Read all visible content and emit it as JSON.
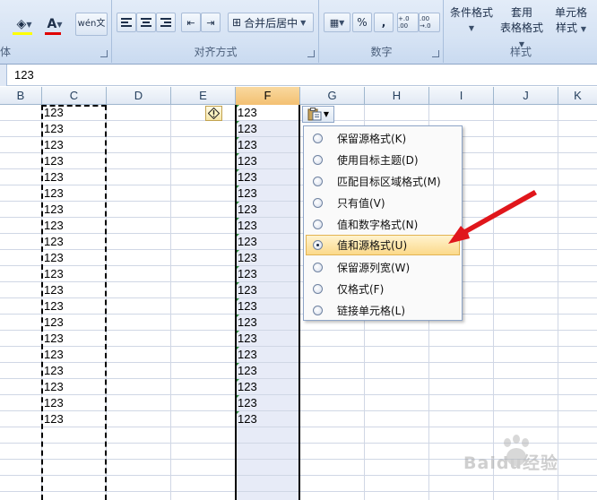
{
  "ribbon": {
    "font_group_label_partial": "体",
    "wen_button": "wén文",
    "alignment_group_label": "对齐方式",
    "merge_center": "合并后居中",
    "number_group_label": "数字",
    "percent": "%",
    "comma": ",",
    "increase_decimal": "+.0 .00",
    "decrease_decimal": ".00 →.0",
    "styles_group_label": "样式",
    "conditional_format": "条件格式",
    "table_format_l1": "套用",
    "table_format_l2": "表格格式",
    "cell_style_l1": "单元格",
    "cell_style_l2": "样式"
  },
  "formula_bar": {
    "value": "123"
  },
  "columns": [
    "B",
    "C",
    "D",
    "E",
    "F",
    "G",
    "H",
    "I",
    "J",
    "K"
  ],
  "selected_column": "F",
  "cells": {
    "C": [
      "123",
      "123",
      "123",
      "123",
      "123",
      "123",
      "123",
      "123",
      "123",
      "123",
      "123",
      "123",
      "123",
      "123",
      "123",
      "123",
      "123",
      "123",
      "123",
      "123"
    ],
    "F": [
      "123",
      "123",
      "123",
      "123",
      "123",
      "123",
      "123",
      "123",
      "123",
      "123",
      "123",
      "123",
      "123",
      "123",
      "123",
      "123",
      "123",
      "123",
      "123",
      "123"
    ]
  },
  "paste_menu": {
    "items": [
      {
        "label": "保留源格式(K)",
        "selected": false
      },
      {
        "label": "使用目标主题(D)",
        "selected": false
      },
      {
        "label": "匹配目标区域格式(M)",
        "selected": false
      },
      {
        "label": "只有值(V)",
        "selected": false
      },
      {
        "label": "值和数字格式(N)",
        "selected": false
      },
      {
        "label": "值和源格式(U)",
        "selected": true
      },
      {
        "label": "保留源列宽(W)",
        "selected": false
      },
      {
        "label": "仅格式(F)",
        "selected": false
      },
      {
        "label": "链接单元格(L)",
        "selected": false
      }
    ]
  },
  "watermark": {
    "text": "Baidu经验"
  },
  "colors": {
    "selected_header": "#f3c072",
    "menu_highlight": "#fbd98a",
    "annotation_arrow": "#e0161b"
  }
}
